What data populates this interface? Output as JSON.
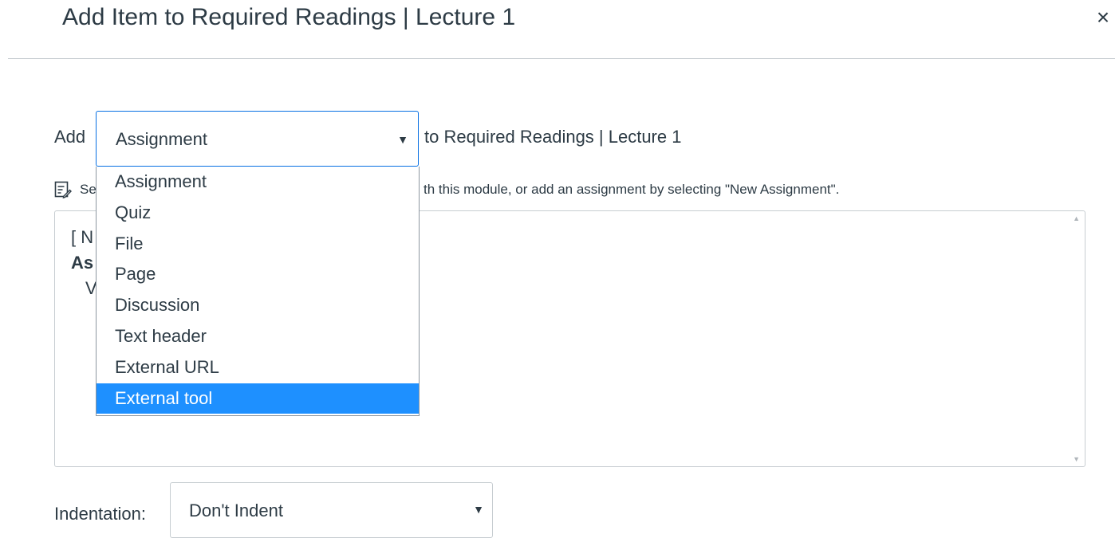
{
  "dialog": {
    "title": "Add Item to Required Readings | Lecture 1",
    "close_label": "×"
  },
  "add_row": {
    "prefix": "Add",
    "suffix": "to Required Readings | Lecture 1",
    "select_value": "Assignment",
    "caret": "▼"
  },
  "type_options": [
    {
      "label": "Assignment",
      "selected": false
    },
    {
      "label": "Quiz",
      "selected": false
    },
    {
      "label": "File",
      "selected": false
    },
    {
      "label": "Page",
      "selected": false
    },
    {
      "label": "Discussion",
      "selected": false
    },
    {
      "label": "Text header",
      "selected": false
    },
    {
      "label": "External URL",
      "selected": false
    },
    {
      "label": "External tool",
      "selected": true
    }
  ],
  "info": {
    "left_text": "Se",
    "right_text": "th this module, or add an assignment by selecting \"New Assignment\"."
  },
  "list_peek": {
    "line1": "[ N",
    "line2": "As",
    "line3": "V"
  },
  "indentation": {
    "label": "Indentation:",
    "value": "Don't Indent",
    "caret": "▼"
  },
  "colors": {
    "accent": "#0770e3",
    "highlight": "#1e90ff",
    "text": "#2d3b45",
    "border": "#c7cdd1"
  }
}
